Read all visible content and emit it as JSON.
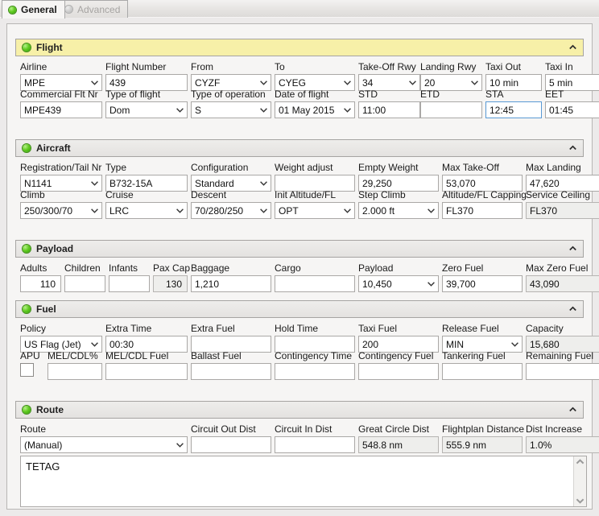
{
  "tabs": [
    {
      "label": "General",
      "state": "active"
    },
    {
      "label": "Advanced",
      "state": "disabled"
    }
  ],
  "sections": {
    "flight": {
      "title": "Flight",
      "fields": {
        "airline": {
          "label": "Airline",
          "value": "MPE"
        },
        "flight_number": {
          "label": "Flight Number",
          "value": "439"
        },
        "from": {
          "label": "From",
          "value": "CYZF"
        },
        "to": {
          "label": "To",
          "value": "CYEG"
        },
        "takeoff_rwy": {
          "label": "Take-Off Rwy",
          "value": "34"
        },
        "landing_rwy": {
          "label": "Landing Rwy",
          "value": "20"
        },
        "taxi_out": {
          "label": "Taxi Out",
          "value": "10 min"
        },
        "taxi_in": {
          "label": "Taxi In",
          "value": "5 min"
        },
        "commercial_flt_nr": {
          "label": "Commercial Flt Nr",
          "value": "MPE439"
        },
        "type_of_flight": {
          "label": "Type of flight",
          "value": "Dom"
        },
        "type_of_operation": {
          "label": "Type of operation",
          "value": "S"
        },
        "date_of_flight": {
          "label": "Date of flight",
          "value": "01 May 2015"
        },
        "std": {
          "label": "STD",
          "value": "11:00"
        },
        "etd": {
          "label": "ETD",
          "value": ""
        },
        "sta": {
          "label": "STA",
          "value": "12:45"
        },
        "eet": {
          "label": "EET",
          "value": "01:45"
        }
      }
    },
    "aircraft": {
      "title": "Aircraft",
      "fields": {
        "registration": {
          "label": "Registration/Tail Nr",
          "value": "N1141"
        },
        "type": {
          "label": "Type",
          "value": "B732-15A"
        },
        "configuration": {
          "label": "Configuration",
          "value": "Standard"
        },
        "weight_adjust": {
          "label": "Weight adjust",
          "value": ""
        },
        "empty_weight": {
          "label": "Empty Weight",
          "value": "29,250"
        },
        "max_take_off": {
          "label": "Max Take-Off",
          "value": "53,070"
        },
        "max_landing": {
          "label": "Max Landing",
          "value": "47,620"
        },
        "climb": {
          "label": "Climb",
          "value": "250/300/70"
        },
        "cruise": {
          "label": "Cruise",
          "value": "LRC"
        },
        "descent": {
          "label": "Descent",
          "value": "70/280/250"
        },
        "init_altitude": {
          "label": "Init Altitude/FL",
          "value": "OPT"
        },
        "step_climb": {
          "label": "Step Climb",
          "value": "2.000 ft"
        },
        "altitude_capping": {
          "label": "Altitude/FL Capping",
          "value": "FL370"
        },
        "service_ceiling": {
          "label": "Service Ceiling",
          "value": "FL370"
        }
      }
    },
    "payload": {
      "title": "Payload",
      "fields": {
        "adults": {
          "label": "Adults",
          "value": "110"
        },
        "children": {
          "label": "Children",
          "value": ""
        },
        "infants": {
          "label": "Infants",
          "value": ""
        },
        "pax_cap": {
          "label": "Pax Cap",
          "value": "130"
        },
        "baggage": {
          "label": "Baggage",
          "value": "1,210"
        },
        "cargo": {
          "label": "Cargo",
          "value": ""
        },
        "payload": {
          "label": "Payload",
          "value": "10,450"
        },
        "zero_fuel": {
          "label": "Zero Fuel",
          "value": "39,700"
        },
        "max_zero_fuel": {
          "label": "Max Zero Fuel",
          "value": "43,090"
        }
      }
    },
    "fuel": {
      "title": "Fuel",
      "fields": {
        "policy": {
          "label": "Policy",
          "value": "US Flag (Jet)"
        },
        "extra_time": {
          "label": "Extra Time",
          "value": "00:30"
        },
        "extra_fuel": {
          "label": "Extra Fuel",
          "value": ""
        },
        "hold_time": {
          "label": "Hold Time",
          "value": ""
        },
        "taxi_fuel": {
          "label": "Taxi Fuel",
          "value": "200"
        },
        "release_fuel": {
          "label": "Release Fuel",
          "value": "MIN"
        },
        "capacity": {
          "label": "Capacity",
          "value": "15,680"
        },
        "apu": {
          "label": "APU",
          "checked": false
        },
        "mel_cdl_pct": {
          "label": "MEL/CDL%",
          "value": ""
        },
        "mel_cdl_fuel": {
          "label": "MEL/CDL Fuel",
          "value": ""
        },
        "ballast_fuel": {
          "label": "Ballast Fuel",
          "value": ""
        },
        "contingency_time": {
          "label": "Contingency Time",
          "value": ""
        },
        "contingency_fuel": {
          "label": "Contingency Fuel",
          "value": ""
        },
        "tankering_fuel": {
          "label": "Tankering Fuel",
          "value": ""
        },
        "remaining_fuel": {
          "label": "Remaining Fuel",
          "value": ""
        }
      }
    },
    "route": {
      "title": "Route",
      "fields": {
        "route": {
          "label": "Route",
          "value": "(Manual)"
        },
        "circuit_out_dist": {
          "label": "Circuit Out Dist",
          "value": ""
        },
        "circuit_in_dist": {
          "label": "Circuit In Dist",
          "value": ""
        },
        "great_circle_dist": {
          "label": "Great Circle Dist",
          "value": "548.8 nm"
        },
        "flightplan_distance": {
          "label": "Flightplan Distance",
          "value": "555.9 nm"
        },
        "dist_increase": {
          "label": "Dist Increase",
          "value": "1.0%"
        }
      },
      "route_text": "TETAG"
    }
  },
  "colors": {
    "header_accent": "#f7f0a8",
    "status_dot": "#62cc22",
    "focus_border": "#5a9ad4",
    "readonly_bg": "#eeeeec"
  }
}
